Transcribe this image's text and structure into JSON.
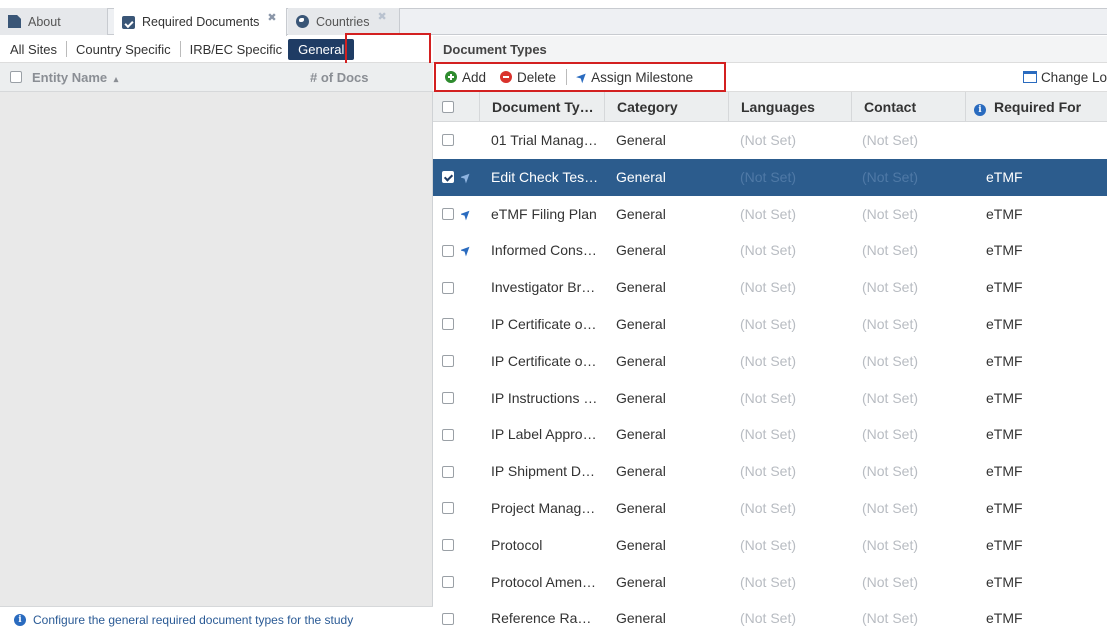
{
  "tabs": [
    {
      "label": "About",
      "icon": "document-icon",
      "closable": false
    },
    {
      "label": "Required Documents",
      "icon": "clipboard-check-icon",
      "closable": true
    },
    {
      "label": "Countries",
      "icon": "globe-icon",
      "closable": true
    }
  ],
  "left_panel": {
    "filters": [
      "All Sites",
      "Country Specific",
      "IRB/EC Specific",
      "General"
    ],
    "selected_filter": "General",
    "columns": {
      "entity_name": "Entity Name",
      "sort_indicator": "▴",
      "num_docs": "# of Docs"
    },
    "footer_hint": "Configure the general required document types for the study"
  },
  "right_panel": {
    "title": "Document Types",
    "toolbar": {
      "add_label": "Add",
      "delete_label": "Delete",
      "assign_milestone_label": "Assign Milestone",
      "change_layout_label": "Change Lo"
    },
    "columns": {
      "document_type": "Document Ty…",
      "category": "Category",
      "languages": "Languages",
      "contact": "Contact",
      "required_for": "Required For"
    },
    "rows": [
      {
        "name": "01 Trial Manag…",
        "category": "General",
        "languages": "(Not Set)",
        "contact": "(Not Set)",
        "required_for": "",
        "milestone": false,
        "checked": false,
        "selected": false
      },
      {
        "name": "Edit Check Tes…",
        "category": "General",
        "languages": "(Not Set)",
        "contact": "(Not Set)",
        "required_for": "eTMF",
        "milestone": true,
        "checked": true,
        "selected": true
      },
      {
        "name": "eTMF Filing Plan",
        "category": "General",
        "languages": "(Not Set)",
        "contact": "(Not Set)",
        "required_for": "eTMF",
        "milestone": true,
        "checked": false,
        "selected": false
      },
      {
        "name": "Informed Cons…",
        "category": "General",
        "languages": "(Not Set)",
        "contact": "(Not Set)",
        "required_for": "eTMF",
        "milestone": true,
        "checked": false,
        "selected": false
      },
      {
        "name": "Investigator Br…",
        "category": "General",
        "languages": "(Not Set)",
        "contact": "(Not Set)",
        "required_for": "eTMF",
        "milestone": false,
        "checked": false,
        "selected": false
      },
      {
        "name": "IP Certificate o…",
        "category": "General",
        "languages": "(Not Set)",
        "contact": "(Not Set)",
        "required_for": "eTMF",
        "milestone": false,
        "checked": false,
        "selected": false
      },
      {
        "name": "IP Certificate o…",
        "category": "General",
        "languages": "(Not Set)",
        "contact": "(Not Set)",
        "required_for": "eTMF",
        "milestone": false,
        "checked": false,
        "selected": false
      },
      {
        "name": "IP Instructions …",
        "category": "General",
        "languages": "(Not Set)",
        "contact": "(Not Set)",
        "required_for": "eTMF",
        "milestone": false,
        "checked": false,
        "selected": false
      },
      {
        "name": "IP Label Appro…",
        "category": "General",
        "languages": "(Not Set)",
        "contact": "(Not Set)",
        "required_for": "eTMF",
        "milestone": false,
        "checked": false,
        "selected": false
      },
      {
        "name": "IP Shipment D…",
        "category": "General",
        "languages": "(Not Set)",
        "contact": "(Not Set)",
        "required_for": "eTMF",
        "milestone": false,
        "checked": false,
        "selected": false
      },
      {
        "name": "Project Manag…",
        "category": "General",
        "languages": "(Not Set)",
        "contact": "(Not Set)",
        "required_for": "eTMF",
        "milestone": false,
        "checked": false,
        "selected": false
      },
      {
        "name": "Protocol",
        "category": "General",
        "languages": "(Not Set)",
        "contact": "(Not Set)",
        "required_for": "eTMF",
        "milestone": false,
        "checked": false,
        "selected": false
      },
      {
        "name": "Protocol Amen…",
        "category": "General",
        "languages": "(Not Set)",
        "contact": "(Not Set)",
        "required_for": "eTMF",
        "milestone": false,
        "checked": false,
        "selected": false
      },
      {
        "name": "Reference Ra…",
        "category": "General",
        "languages": "(Not Set)",
        "contact": "(Not Set)",
        "required_for": "eTMF",
        "milestone": false,
        "checked": false,
        "selected": false
      }
    ]
  },
  "colors": {
    "selected_row": "#2c5c8d",
    "active_filter": "#1f3c64",
    "highlight_border": "#d32020",
    "accent_blue": "#2a6bbf"
  }
}
